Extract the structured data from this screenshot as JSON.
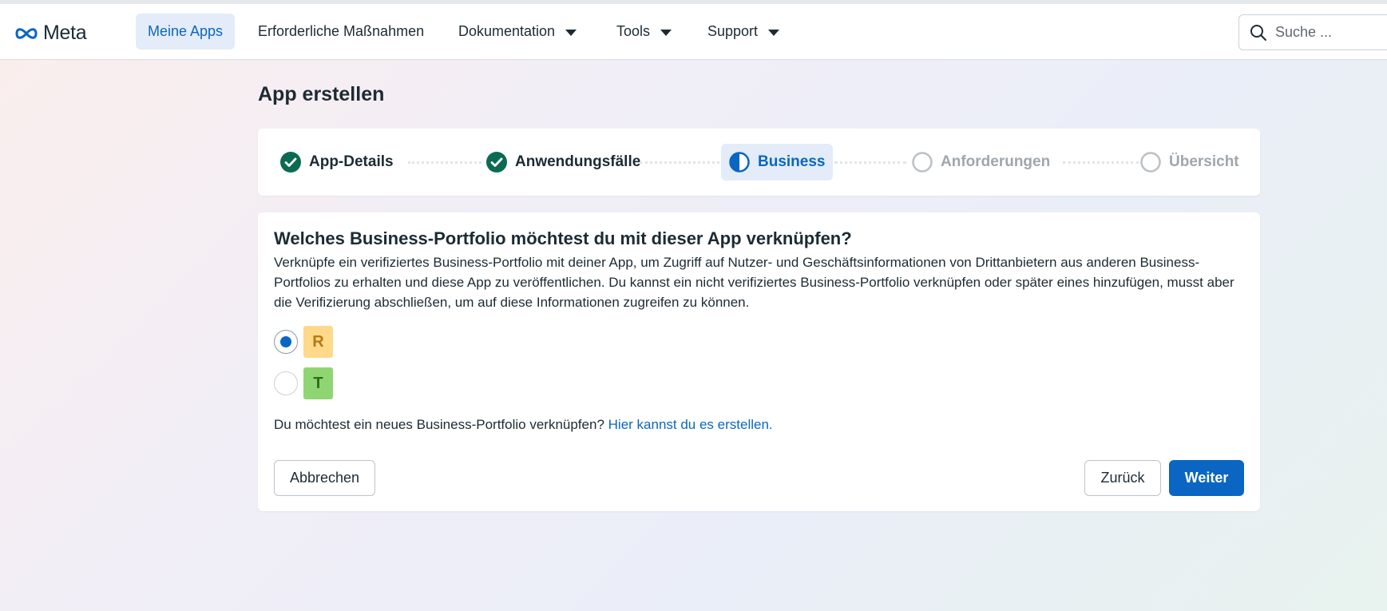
{
  "nav": {
    "brand": "Meta",
    "items": [
      {
        "label": "Meine Apps",
        "active": true
      },
      {
        "label": "Erforderliche Maßnahmen"
      },
      {
        "label": "Dokumentation"
      },
      {
        "label": "Tools"
      },
      {
        "label": "Support"
      }
    ],
    "search_placeholder": "Suche ..."
  },
  "page": {
    "title": "App erstellen"
  },
  "stepper": {
    "steps": [
      {
        "label": "App-Details",
        "state": "done"
      },
      {
        "label": "Anwendungsfälle",
        "state": "done"
      },
      {
        "label": "Business",
        "state": "current"
      },
      {
        "label": "Anforderungen",
        "state": "pending"
      },
      {
        "label": "Übersicht",
        "state": "pending"
      }
    ]
  },
  "card": {
    "heading": "Welches Business-Portfolio möchtest du mit dieser App verknüpfen?",
    "description": "Verknüpfe ein verifiziertes Business-Portfolio mit deiner App, um Zugriff auf Nutzer- und Geschäftsinformationen von Drittanbietern aus anderen Business-Portfolios zu erhalten und diese App zu veröffentlichen. Du kannst ein nicht verifiziertes Business-Portfolio verknüpfen oder später eines hinzufügen, musst aber die Verifizierung abschließen, um auf diese Informationen zugreifen zu können.",
    "options": [
      {
        "initial": "R",
        "selected": true,
        "bg": "#ffd98a",
        "fg": "#b27b12"
      },
      {
        "initial": "T",
        "selected": false,
        "bg": "#8fd672",
        "fg": "#2f6b1c"
      }
    ],
    "hint_text": "Du möchtest ein neues Business-Portfolio verknüpfen?",
    "hint_link": "Hier kannst du es erstellen.",
    "cancel_label": "Abbrechen",
    "back_label": "Zurück",
    "next_label": "Weiter"
  },
  "colors": {
    "accent": "#0a66c2",
    "done": "#0b6b52"
  }
}
